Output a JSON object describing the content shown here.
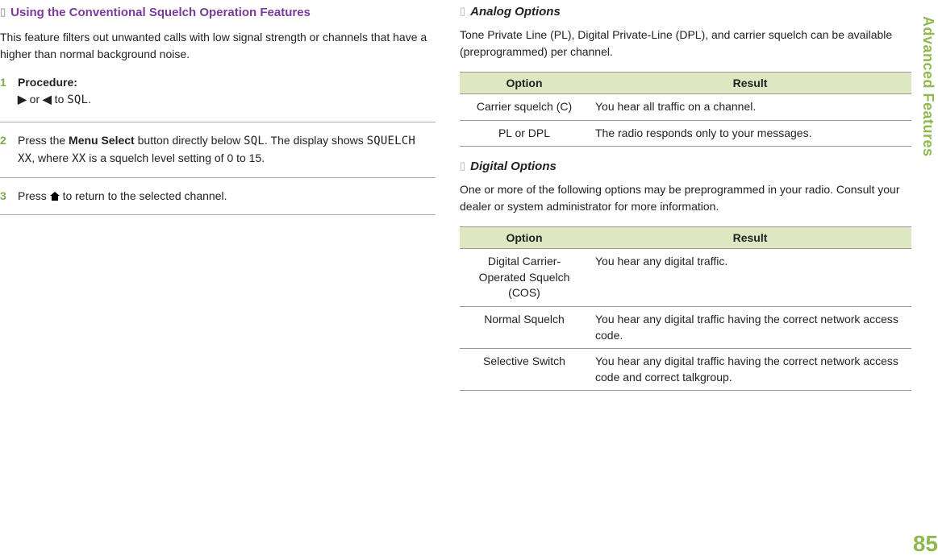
{
  "sidebar": {
    "label": "Advanced Features"
  },
  "page_number": "85",
  "left": {
    "heading": "Using the Conventional Squelch Operation Features",
    "intro": "This feature filters out unwanted calls with low signal strength or channels that have a higher than normal background noise.",
    "step1_num": "1",
    "step1_label": "Procedure:",
    "step1_arrow1": "▶",
    "step1_or": " or ",
    "step1_arrow2": "◀",
    "step1_to": " to ",
    "step1_code": "SQL",
    "step1_dot": ".",
    "step2_num": "2",
    "step2_a": "Press the ",
    "step2_bold": "Menu Select",
    "step2_b": " button directly below ",
    "step2_code1": "SQL",
    "step2_c": ". The display shows ",
    "step2_code2": "SQUELCH XX",
    "step2_d": ", where ",
    "step2_code3": "XX",
    "step2_e": " is a squelch level setting of 0 to 15.",
    "step3_num": "3",
    "step3_a": "Press ",
    "step3_b": " to return to the selected channel."
  },
  "right": {
    "analog": {
      "heading": "Analog Options",
      "intro": "Tone Private Line (PL), Digital Private-Line (DPL), and carrier squelch can be available (preprogrammed) per channel.",
      "th1": "Option",
      "th2": "Result",
      "r1c1": "Carrier squelch (C)",
      "r1c2": "You hear all traffic on a channel.",
      "r2c1": "PL or DPL",
      "r2c2": "The radio responds only to your messages."
    },
    "digital": {
      "heading": "Digital Options",
      "intro": "One or more of the following options may be preprogrammed in your radio. Consult your dealer or system administrator for more information.",
      "th1": "Option",
      "th2": "Result",
      "r1c1": "Digital Carrier-Operated Squelch (COS)",
      "r1c2": "You hear any digital traffic.",
      "r2c1": "Normal Squelch",
      "r2c2": "You hear any digital traffic having the correct network access code.",
      "r3c1": "Selective Switch",
      "r3c2": "You hear any digital traffic having the correct network access code and correct talkgroup."
    }
  }
}
